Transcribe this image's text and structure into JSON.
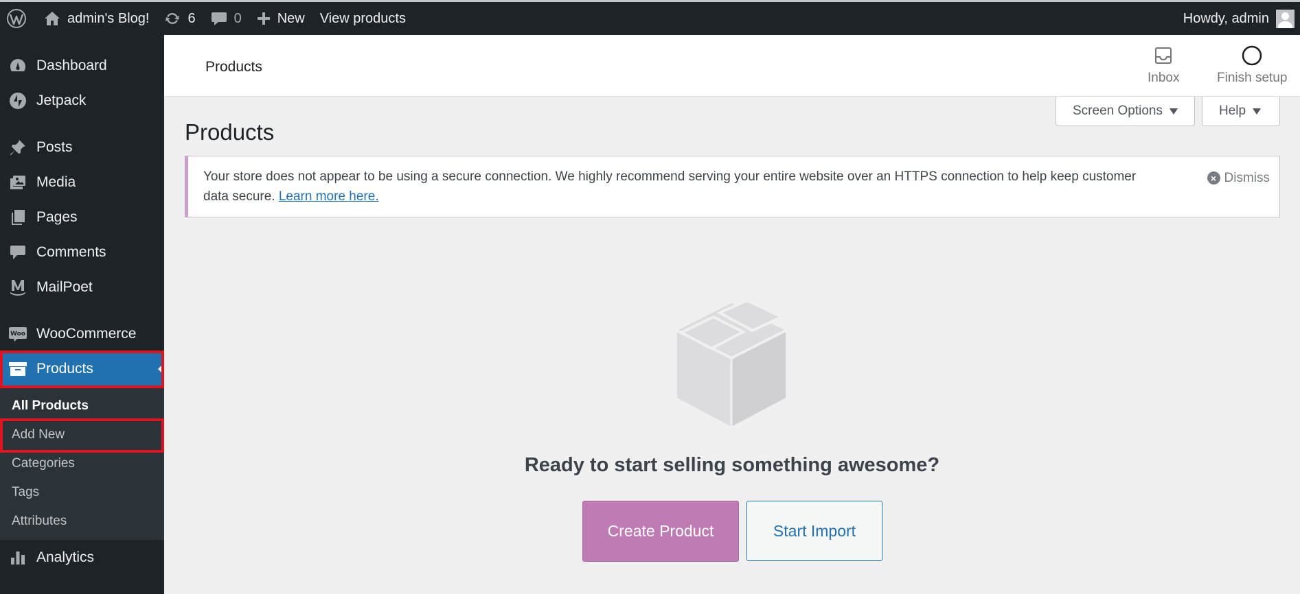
{
  "adminbar": {
    "site_name": "admin's Blog!",
    "updates_count": "6",
    "comments_count": "0",
    "new_label": "New",
    "view_products_label": "View products",
    "greeting": "Howdy, admin"
  },
  "sidebar": {
    "items": [
      {
        "label": "Dashboard",
        "icon": "dashboard-icon"
      },
      {
        "label": "Jetpack",
        "icon": "jetpack-icon"
      },
      {
        "label": "Posts",
        "icon": "pin-icon"
      },
      {
        "label": "Media",
        "icon": "media-icon"
      },
      {
        "label": "Pages",
        "icon": "pages-icon"
      },
      {
        "label": "Comments",
        "icon": "comment-icon"
      },
      {
        "label": "MailPoet",
        "icon": "mailpoet-icon"
      },
      {
        "label": "WooCommerce",
        "icon": "woo-icon"
      },
      {
        "label": "Products",
        "icon": "archive-icon"
      },
      {
        "label": "Analytics",
        "icon": "bar-chart-icon"
      }
    ],
    "submenu": [
      {
        "label": "All Products"
      },
      {
        "label": "Add New"
      },
      {
        "label": "Categories"
      },
      {
        "label": "Tags"
      },
      {
        "label": "Attributes"
      }
    ]
  },
  "header": {
    "title": "Products",
    "inbox_label": "Inbox",
    "finish_setup_label": "Finish setup"
  },
  "screen_meta": {
    "screen_options_label": "Screen Options",
    "help_label": "Help"
  },
  "page": {
    "title": "Products",
    "notice_text": "Your store does not appear to be using a secure connection. We highly recommend serving your entire website over an HTTPS connection to help keep customer data secure.",
    "notice_link": "Learn more here.",
    "dismiss_label": "Dismiss",
    "empty_message": "Ready to start selling something awesome?",
    "create_product_label": "Create Product",
    "start_import_label": "Start Import"
  },
  "colors": {
    "admin_bar": "#1d2327",
    "current_menu": "#2271b1",
    "woo_primary": "#bf7bb3",
    "highlight_outline": "#e0141e"
  }
}
